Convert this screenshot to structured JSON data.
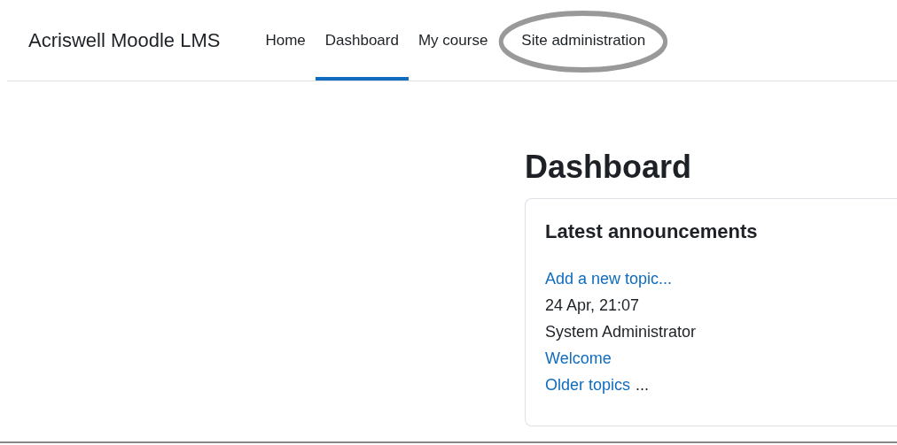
{
  "brand": "Acriswell Moodle LMS",
  "nav": [
    {
      "label": "Home",
      "selected": false,
      "highlighted": false
    },
    {
      "label": "Dashboard",
      "selected": true,
      "highlighted": false
    },
    {
      "label": "My course",
      "selected": false,
      "highlighted": false
    },
    {
      "label": "Site administration",
      "selected": false,
      "highlighted": true
    }
  ],
  "page_title": "Dashboard",
  "block": {
    "title": "Latest announcements",
    "lines": [
      {
        "kind": "link",
        "text": "Add a new topic..."
      },
      {
        "kind": "text",
        "text": "24 Apr, 21:07"
      },
      {
        "kind": "text",
        "text": "System Administrator"
      },
      {
        "kind": "link",
        "text": "Welcome"
      },
      {
        "kind": "link",
        "text": "Older topics",
        "suffix": "..."
      }
    ]
  }
}
